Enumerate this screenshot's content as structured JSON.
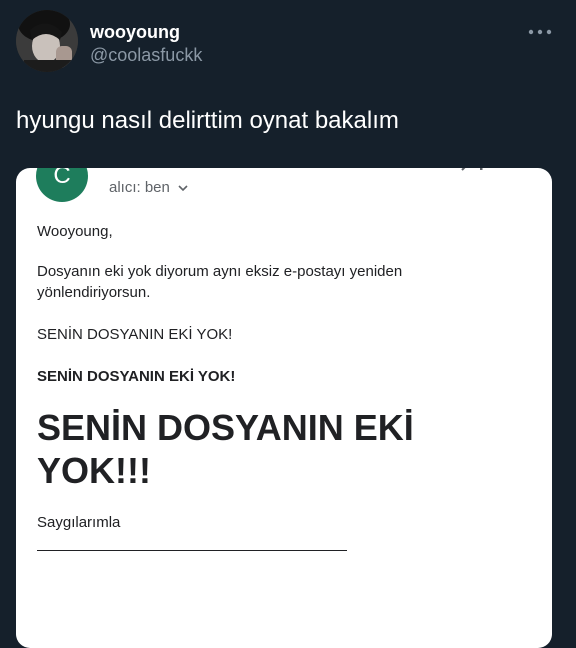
{
  "tweet": {
    "display_name": "wooyoung",
    "handle": "@coolasfuckk",
    "text": "hyungu nasıl delirttim oynat bakalım"
  },
  "email": {
    "sender_initial": "C",
    "recipient_label": "alıcı: ben",
    "greeting": "Wooyoung,",
    "paragraph": "Dosyanın eki yok diyorum aynı eksiz e-postayı yeniden yönlendiriyorsun.",
    "line_regular": "SENİN DOSYANIN EKİ YOK!",
    "line_bold": "SENİN DOSYANIN EKİ YOK!",
    "headline": "SENİN DOSYANIN EKİ YOK!!!",
    "signoff": "Saygılarımla"
  },
  "colors": {
    "background": "#15202b",
    "secondary_text": "#8b98a5",
    "sender_avatar": "#1e7d5c",
    "card": "#ffffff"
  },
  "icons": {
    "more": "more-horizontal-icon",
    "recipient_expand": "chevron-down-icon"
  }
}
